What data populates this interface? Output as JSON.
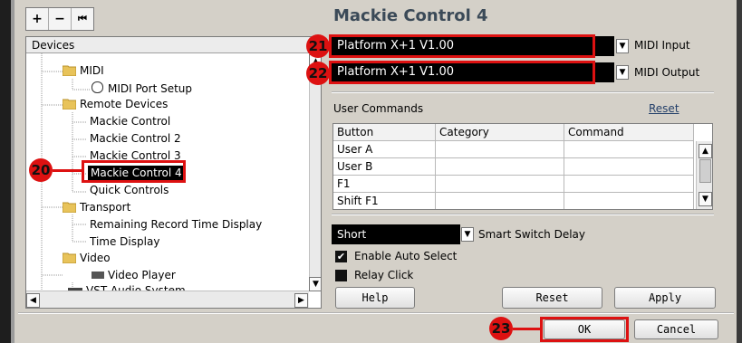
{
  "toolbar": {
    "add": "+",
    "remove": "−",
    "reset": "⏮"
  },
  "tree": {
    "header": "Devices",
    "items": [
      {
        "label": "MIDI",
        "type": "folder"
      },
      {
        "label": "MIDI Port Setup",
        "type": "leaf-icon"
      },
      {
        "label": "Remote Devices",
        "type": "folder"
      },
      {
        "label": "Mackie Control",
        "type": "leaf"
      },
      {
        "label": "Mackie Control 2",
        "type": "leaf"
      },
      {
        "label": "Mackie Control 3",
        "type": "leaf"
      },
      {
        "label": "Mackie Control 4",
        "type": "selected"
      },
      {
        "label": "Quick Controls",
        "type": "leaf"
      },
      {
        "label": "Transport",
        "type": "folder"
      },
      {
        "label": "Remaining Record Time Display",
        "type": "leaf"
      },
      {
        "label": "Time Display",
        "type": "leaf"
      },
      {
        "label": "Video",
        "type": "folder"
      },
      {
        "label": "Video Player",
        "type": "leaf-icon"
      },
      {
        "label": "VST Audio System",
        "type": "leaf-icon"
      }
    ]
  },
  "panel": {
    "title": "Mackie Control 4",
    "midi_input": {
      "value": "Platform X+1 V1.00",
      "label": "MIDI Input"
    },
    "midi_output": {
      "value": "Platform X+1 V1.00",
      "label": "MIDI Output"
    },
    "user_commands": {
      "label": "User Commands",
      "reset_link": "Reset",
      "columns": [
        "Button",
        "Category",
        "Command"
      ],
      "rows": [
        "User A",
        "User B",
        "F1",
        "Shift F1"
      ]
    },
    "smart_switch": {
      "value": "Short",
      "label": "Smart Switch Delay"
    },
    "enable_auto_select": {
      "label": "Enable Auto Select",
      "checked": "✔"
    },
    "relay_click": {
      "label": "Relay Click"
    },
    "buttons": {
      "help": "Help",
      "reset": "Reset",
      "apply": "Apply"
    }
  },
  "footer": {
    "ok": "OK",
    "cancel": "Cancel"
  },
  "callouts": [
    "20",
    "21",
    "22",
    "23"
  ],
  "colors": {
    "callout": "#dd1111",
    "title": "#3b4a58",
    "selection": "#000000"
  }
}
